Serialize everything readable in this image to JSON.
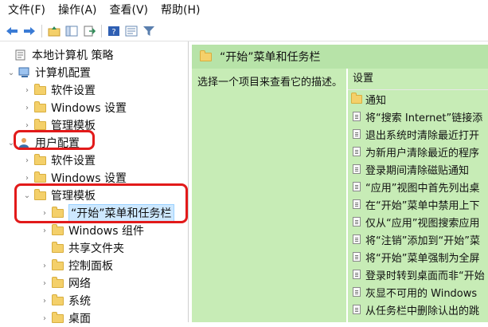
{
  "menu": [
    "文件(F)",
    "操作(A)",
    "查看(V)",
    "帮助(H)"
  ],
  "toolbar": {
    "icons": [
      "back-arrow-icon",
      "forward-arrow-icon",
      "up-folder-icon",
      "show-hide-tree-icon",
      "export-icon",
      "help-icon",
      "properties-icon",
      "filter-icon"
    ]
  },
  "tree": {
    "root": "本地计算机 策略",
    "computer_config": "计算机配置",
    "computer_software": "软件设置",
    "computer_windows": "Windows 设置",
    "computer_admin": "管理模板",
    "user_config": "用户配置",
    "user_software": "软件设置",
    "user_windows": "Windows 设置",
    "user_admin": "管理模板",
    "start_menu": "“开始”菜单和任务栏",
    "win_components": "Windows 组件",
    "shared_folders": "共享文件夹",
    "control_panel": "控制面板",
    "network": "网络",
    "system": "系统",
    "desktop": "桌面"
  },
  "detail": {
    "header": "“开始”菜单和任务栏",
    "description": "选择一个项目来查看它的描述。",
    "column": "设置",
    "items": [
      {
        "icon": "folder-icon",
        "label": "通知"
      },
      {
        "icon": "policy-icon",
        "label": "将“搜索 Internet”链接添"
      },
      {
        "icon": "policy-icon",
        "label": "退出系统时清除最近打开"
      },
      {
        "icon": "policy-icon",
        "label": "为新用户清除最近的程序"
      },
      {
        "icon": "policy-icon",
        "label": "登录期间清除磁贴通知"
      },
      {
        "icon": "policy-icon",
        "label": "“应用”视图中首先列出桌"
      },
      {
        "icon": "policy-icon",
        "label": "在“开始”菜单中禁用上下"
      },
      {
        "icon": "policy-icon",
        "label": "仅从“应用”视图搜索应用"
      },
      {
        "icon": "policy-icon",
        "label": "将“注销”添加到“开始”菜"
      },
      {
        "icon": "policy-icon",
        "label": "将“开始”菜单强制为全屏"
      },
      {
        "icon": "policy-icon",
        "label": "登录时转到桌面而非“开始"
      },
      {
        "icon": "policy-icon",
        "label": "灰显不可用的 Windows"
      },
      {
        "icon": "policy-icon",
        "label": "从任务栏中删除认出的跳"
      }
    ]
  },
  "colors": {
    "highlight_green": "#c7ecb6",
    "header_green": "#b7e3a8",
    "annotation_red": "#e21a1a",
    "selection": "#cde8ff"
  }
}
